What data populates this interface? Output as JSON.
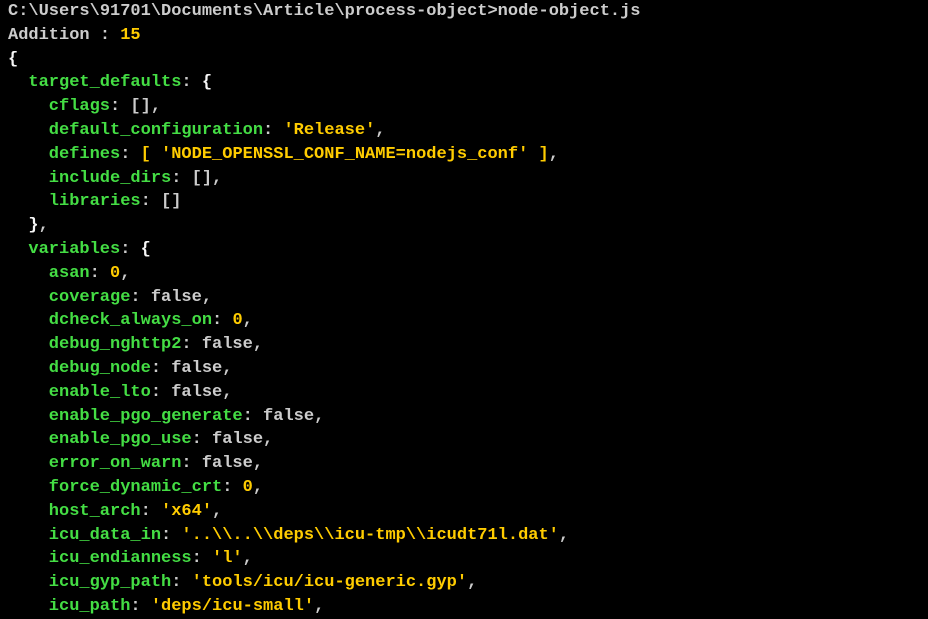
{
  "header": {
    "path_line": "C:\\Users\\91701\\Documents\\Article\\process-object>node-object.js",
    "addition_label": "Addition : ",
    "addition_value": "15"
  },
  "obj": {
    "target_defaults": {
      "key": "target_defaults",
      "cflags_key": "cflags",
      "cflags_val": "[]",
      "default_configuration_key": "default_configuration",
      "default_configuration_val": "'Release'",
      "defines_key": "defines",
      "defines_val": "[ 'NODE_OPENSSL_CONF_NAME=nodejs_conf' ]",
      "include_dirs_key": "include_dirs",
      "include_dirs_val": "[]",
      "libraries_key": "libraries",
      "libraries_val": "[]"
    },
    "variables": {
      "key": "variables",
      "asan_key": "asan",
      "asan_val": "0",
      "coverage_key": "coverage",
      "coverage_val": "false",
      "dcheck_always_on_key": "dcheck_always_on",
      "dcheck_always_on_val": "0",
      "debug_nghttp2_key": "debug_nghttp2",
      "debug_nghttp2_val": "false",
      "debug_node_key": "debug_node",
      "debug_node_val": "false",
      "enable_lto_key": "enable_lto",
      "enable_lto_val": "false",
      "enable_pgo_generate_key": "enable_pgo_generate",
      "enable_pgo_generate_val": "false",
      "enable_pgo_use_key": "enable_pgo_use",
      "enable_pgo_use_val": "false",
      "error_on_warn_key": "error_on_warn",
      "error_on_warn_val": "false",
      "force_dynamic_crt_key": "force_dynamic_crt",
      "force_dynamic_crt_val": "0",
      "host_arch_key": "host_arch",
      "host_arch_val": "'x64'",
      "icu_data_in_key": "icu_data_in",
      "icu_data_in_val": "'..\\\\..\\\\deps\\\\icu-tmp\\\\icudt71l.dat'",
      "icu_endianness_key": "icu_endianness",
      "icu_endianness_val": "'l'",
      "icu_gyp_path_key": "icu_gyp_path",
      "icu_gyp_path_val": "'tools/icu/icu-generic.gyp'",
      "icu_path_key": "icu_path",
      "icu_path_val": "'deps/icu-small'"
    }
  }
}
